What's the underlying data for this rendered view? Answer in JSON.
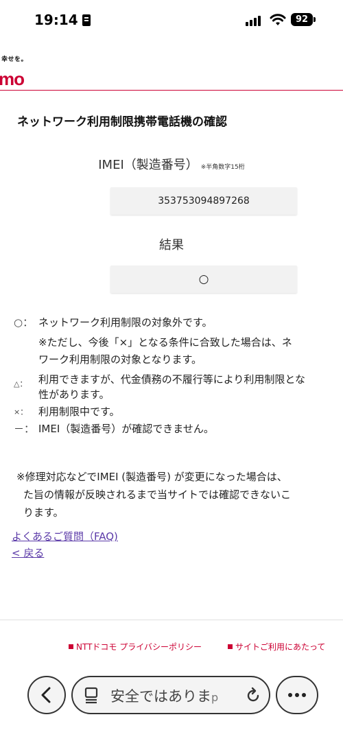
{
  "status_bar": {
    "time": "19:14",
    "battery": "92"
  },
  "brand": {
    "tagline": "幸せを。",
    "logo": "mo"
  },
  "page": {
    "title": "ネットワーク利用制限携帯電話機の確認",
    "imei_label": "IMEI（製造番号）",
    "imei_note": "※半角数字15桁",
    "imei_value": "353753094897268",
    "result_label": "結果",
    "result_value": "○"
  },
  "legend": [
    {
      "symbol": "○：",
      "lines": [
        "ネットワーク利用制限の対象外です。",
        "※ただし、今後「×」となる条件に合致した場合は、ネ",
        "ワーク利用制限の対象となります。"
      ]
    },
    {
      "symbol": "△：",
      "lines": [
        "利用できますが、代金債務の不履行等により利用制限とな",
        "性があります。"
      ]
    },
    {
      "symbol": "×：",
      "lines": [
        "利用制限中です。"
      ]
    },
    {
      "symbol": "－：",
      "lines": [
        "IMEI（製造番号）が確認できません。"
      ]
    }
  ],
  "repair_note": [
    "※修理対応などでIMEI (製造番号) が変更になった場合は、",
    "た旨の情報が反映されるまで当サイトでは確認できないこ",
    "ります。"
  ],
  "links": {
    "faq": "よくあるご質問（FAQ)",
    "back": "< 戻る"
  },
  "footer": {
    "privacy": "NTTドコモ プライバシーポリシー",
    "terms": "サイトご利用にあたって"
  },
  "browser": {
    "address": "安全ではありま",
    "address_tail": "p"
  },
  "colors": {
    "brand_red": "#cc0033",
    "link": "#5b3aa8"
  }
}
